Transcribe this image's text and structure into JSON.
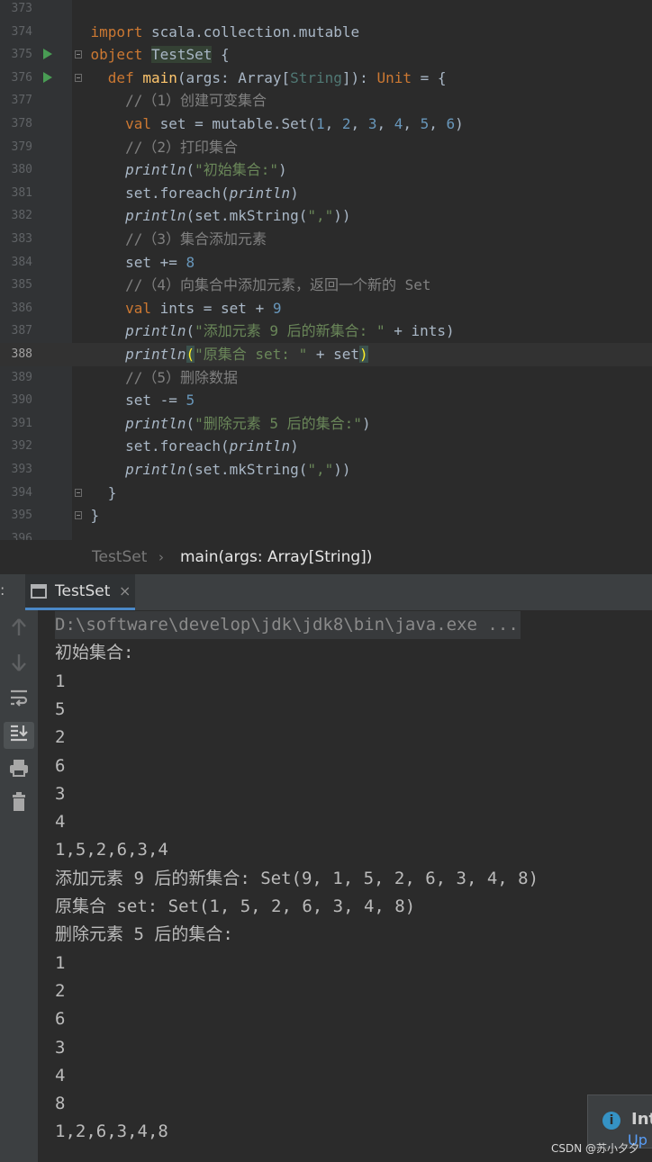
{
  "editor": {
    "lines": [
      {
        "n": "373",
        "html": ""
      },
      {
        "n": "374",
        "html": "    <span class=\"kw\">import</span> scala.collection.mutable"
      },
      {
        "n": "375",
        "html": "    <span class=\"kw\">object</span> <span class=\"hl\">TestSet</span> {"
      },
      {
        "n": "376",
        "html": "      <span class=\"kw\">def</span> <span class=\"fn\">main</span>(args: Array[<span class=\"ty\">String</span>]): <span class=\"kw\">Unit</span> = {"
      },
      {
        "n": "377",
        "html": "        <span class=\"cm\">//（1）创建可变集合</span>"
      },
      {
        "n": "378",
        "html": "        <span class=\"kw\">val</span> set = mutable.Set(<span class=\"num\">1</span>, <span class=\"num\">2</span>, <span class=\"num\">3</span>, <span class=\"num\">4</span>, <span class=\"num\">5</span>, <span class=\"num\">6</span>)"
      },
      {
        "n": "379",
        "html": "        <span class=\"cm\">//（2）打印集合</span>"
      },
      {
        "n": "380",
        "html": "        <span class=\"it\">println</span>(<span class=\"str\">\"初始集合:\"</span>)"
      },
      {
        "n": "381",
        "html": "        set.foreach(<span class=\"it\">println</span>)"
      },
      {
        "n": "382",
        "html": "        <span class=\"it\">println</span>(set.mkString(<span class=\"str\">\",\"</span>))"
      },
      {
        "n": "383",
        "html": "        <span class=\"cm\">//（3）集合添加元素</span>"
      },
      {
        "n": "384",
        "html": "        set += <span class=\"num\">8</span>"
      },
      {
        "n": "385",
        "html": "        <span class=\"cm\">//（4）向集合中添加元素，返回一个新的 Set</span>"
      },
      {
        "n": "386",
        "html": "        <span class=\"kw\">val</span> ints = set + <span class=\"num\">9</span>"
      },
      {
        "n": "387",
        "html": "        <span class=\"it\">println</span>(<span class=\"str\">\"添加元素 9 后的新集合: \"</span> + ints)"
      },
      {
        "n": "388",
        "html": "        <span class=\"it\">println</span><span class=\"brk\">(</span><span class=\"str\">\"原集合 set: \"</span> + set<span class=\"brk\">)</span>"
      },
      {
        "n": "389",
        "html": "        <span class=\"cm\">//（5）删除数据</span>"
      },
      {
        "n": "390",
        "html": "        set -= <span class=\"num\">5</span>"
      },
      {
        "n": "391",
        "html": "        <span class=\"it\">println</span>(<span class=\"str\">\"删除元素 5 后的集合:\"</span>)"
      },
      {
        "n": "392",
        "html": "        set.foreach(<span class=\"it\">println</span>)"
      },
      {
        "n": "393",
        "html": "        <span class=\"it\">println</span>(set.mkString(<span class=\"str\">\",\"</span>))"
      },
      {
        "n": "394",
        "html": "      }"
      },
      {
        "n": "395",
        "html": "    }"
      },
      {
        "n": "396",
        "html": ""
      }
    ],
    "current_line": "388"
  },
  "breadcrumb": {
    "object": "TestSet",
    "separator": "›",
    "method": "main(args: Array[String])"
  },
  "run_window": {
    "tab_edge": ":",
    "tab_label": "TestSet",
    "tab_close": "×",
    "tools": [
      "up-arrow-icon",
      "down-arrow-icon",
      "soft-wrap-icon",
      "scroll-to-end-icon",
      "print-icon",
      "trash-icon"
    ],
    "console_lines": [
      "D:\\software\\develop\\jdk\\jdk8\\bin\\java.exe ...",
      "初始集合:",
      "1",
      "5",
      "2",
      "6",
      "3",
      "4",
      "1,5,2,6,3,4",
      "添加元素 9 后的新集合: Set(9, 1, 5, 2, 6, 3, 4, 8)",
      "原集合 set: Set(1, 5, 2, 6, 3, 4, 8)",
      "删除元素 5 后的集合:",
      "1",
      "2",
      "6",
      "3",
      "4",
      "8",
      "1,2,6,3,4,8"
    ]
  },
  "notification": {
    "title": "Int",
    "sub": "Up"
  },
  "watermark": "CSDN @苏小夕夕",
  "colors": {
    "background": "#2b2b2b",
    "keyword": "#cc7832",
    "string": "#6a8759",
    "number": "#6897bb",
    "function": "#ffc66d",
    "comment": "#808080"
  }
}
